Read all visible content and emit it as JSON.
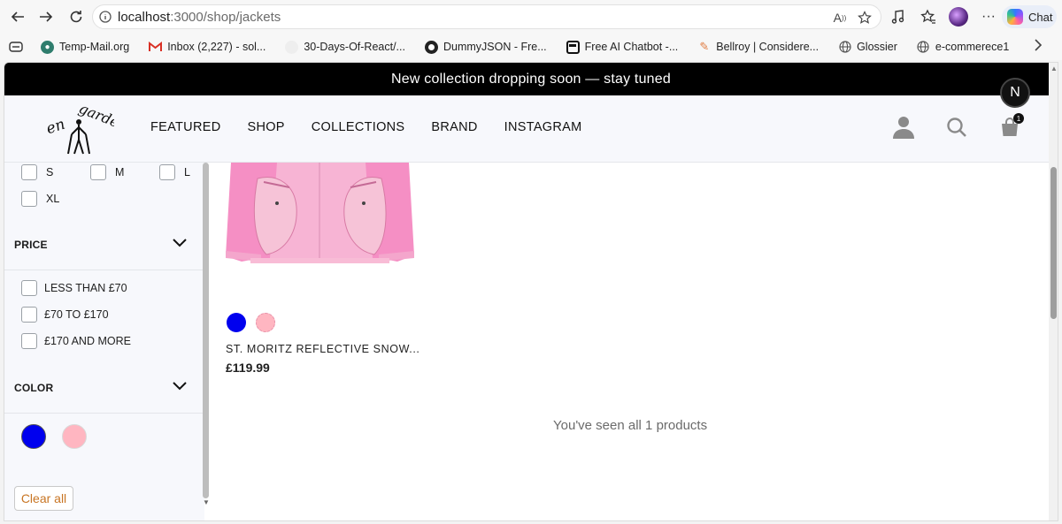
{
  "browser": {
    "url_host": "localhost",
    "url_path": ":3000/shop/jackets",
    "chat_label": "Chat",
    "more_icon": "ellipsis-icon"
  },
  "bookmarks": [
    {
      "label": "Temp-Mail.org",
      "icon": "temp-mail-icon",
      "color": "#2f7d6d"
    },
    {
      "label": "Inbox (2,227) - sol...",
      "icon": "gmail-icon",
      "color": "#d93025"
    },
    {
      "label": "30-Days-Of-React/...",
      "icon": "github-icon",
      "color": "#cccccc"
    },
    {
      "label": "DummyJSON - Fre...",
      "icon": "dummyjson-icon",
      "color": "#222222"
    },
    {
      "label": "Free AI Chatbot -...",
      "icon": "chatbot-icon",
      "color": "#111111"
    },
    {
      "label": "Bellroy | Considere...",
      "icon": "bellroy-icon",
      "color": "#e07a3f"
    },
    {
      "label": "Glossier",
      "icon": "globe-icon",
      "color": "#555555"
    },
    {
      "label": "e-commerece1",
      "icon": "globe-icon",
      "color": "#555555"
    }
  ],
  "announcement": "New collection dropping soon — stay tuned",
  "nav": {
    "items": [
      "FEATURED",
      "SHOP",
      "COLLECTIONS",
      "BRAND",
      "INSTAGRAM"
    ],
    "cart_count": "1",
    "next_badge": "N"
  },
  "filters": {
    "sizes": [
      "S",
      "M",
      "L",
      "XL"
    ],
    "price_title": "PRICE",
    "price_options": [
      "LESS THAN £70",
      "£70 TO £170",
      "£170 AND MORE"
    ],
    "color_title": "COLOR",
    "colors": [
      "#0000ee",
      "#ffb6c1"
    ],
    "clear_label": "Clear all"
  },
  "product": {
    "name": "ST. MORITZ REFLECTIVE SNOW...",
    "price": "£119.99",
    "colors": [
      "#0000ee",
      "#ffb6c1"
    ]
  },
  "seen_message": "You've seen all 1 products"
}
